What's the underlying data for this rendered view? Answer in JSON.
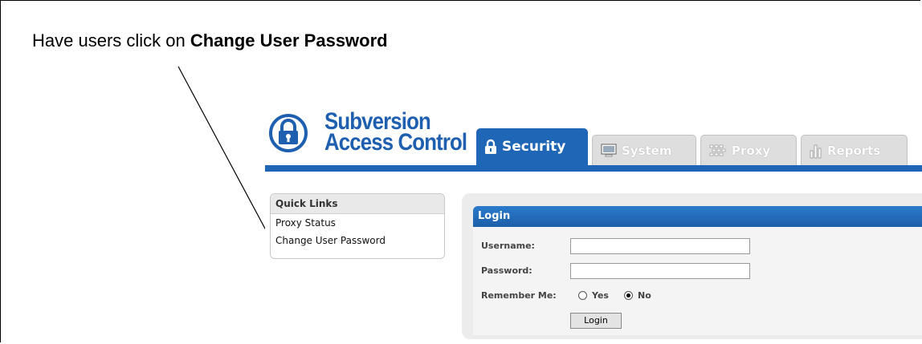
{
  "caption": {
    "prefix": "Have users click on ",
    "bold": "Change User Password"
  },
  "brand": {
    "line1": "Subversion",
    "line2": "Access Control"
  },
  "tabs": [
    {
      "label": "Security",
      "icon": "lock-icon",
      "active": true
    },
    {
      "label": "System",
      "icon": "monitor-icon",
      "active": false
    },
    {
      "label": "Proxy",
      "icon": "network-icon",
      "active": false
    },
    {
      "label": "Reports",
      "icon": "bar-chart-icon",
      "active": false
    }
  ],
  "quick_links": {
    "title": "Quick Links",
    "items": [
      "Proxy Status",
      "Change User Password"
    ]
  },
  "login": {
    "title": "Login",
    "username_label": "Username:",
    "password_label": "Password:",
    "username_value": "",
    "password_value": "",
    "remember_label": "Remember Me:",
    "remember_options": [
      "Yes",
      "No"
    ],
    "remember_selected": "No",
    "button_label": "Login"
  },
  "colors": {
    "brand_blue": "#1f66b6",
    "logo_blue": "#1f5fb0"
  }
}
